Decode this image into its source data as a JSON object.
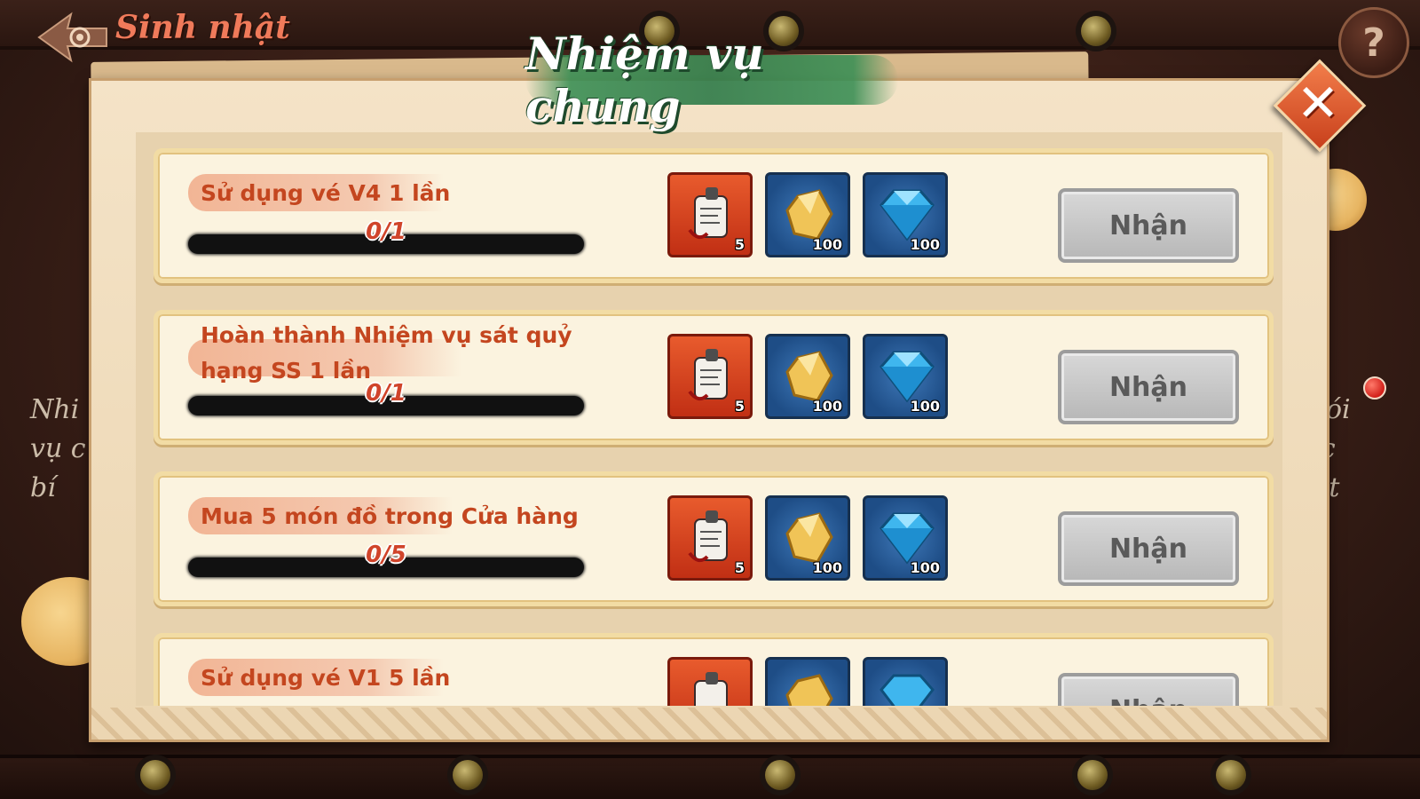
{
  "header": {
    "title": "Sinh nhật",
    "help_label": "?"
  },
  "side_text": {
    "left": "Nhi\nvụ c\nbí",
    "right": "Gói\nặc\niệt"
  },
  "dialog": {
    "title": "Nhiệm vụ chung",
    "close_label": "✕",
    "tasks": [
      {
        "name": "Sử dụng vé V4 1 lần",
        "progress_text": "0/1",
        "progress": 0,
        "rewards": [
          {
            "icon": "scroll-icon",
            "qty": "5"
          },
          {
            "icon": "gold-crystal-icon",
            "qty": "100"
          },
          {
            "icon": "diamond-icon",
            "qty": "100"
          }
        ],
        "claim_label": "Nhận"
      },
      {
        "name": "Hoàn thành Nhiệm vụ sát quỷ hạng SS 1 lần",
        "progress_text": "0/1",
        "progress": 0,
        "rewards": [
          {
            "icon": "scroll-icon",
            "qty": "5"
          },
          {
            "icon": "gold-crystal-icon",
            "qty": "100"
          },
          {
            "icon": "diamond-icon",
            "qty": "100"
          }
        ],
        "claim_label": "Nhận"
      },
      {
        "name": "Mua 5 món đồ trong Cửa hàng",
        "progress_text": "0/5",
        "progress": 0,
        "rewards": [
          {
            "icon": "scroll-icon",
            "qty": "5"
          },
          {
            "icon": "gold-crystal-icon",
            "qty": "100"
          },
          {
            "icon": "diamond-icon",
            "qty": "100"
          }
        ],
        "claim_label": "Nhận"
      },
      {
        "name": "Sử dụng vé V1 5 lần",
        "progress_text": "",
        "progress": 0,
        "rewards": [
          {
            "icon": "scroll-icon",
            "qty": ""
          },
          {
            "icon": "gold-crystal-icon",
            "qty": ""
          },
          {
            "icon": "diamond-icon",
            "qty": ""
          }
        ],
        "claim_label": "Nhận"
      }
    ]
  },
  "colors": {
    "accent": "#c4461f",
    "title_green": "#2e7a48",
    "claim_disabled": "#b7b7b7"
  }
}
